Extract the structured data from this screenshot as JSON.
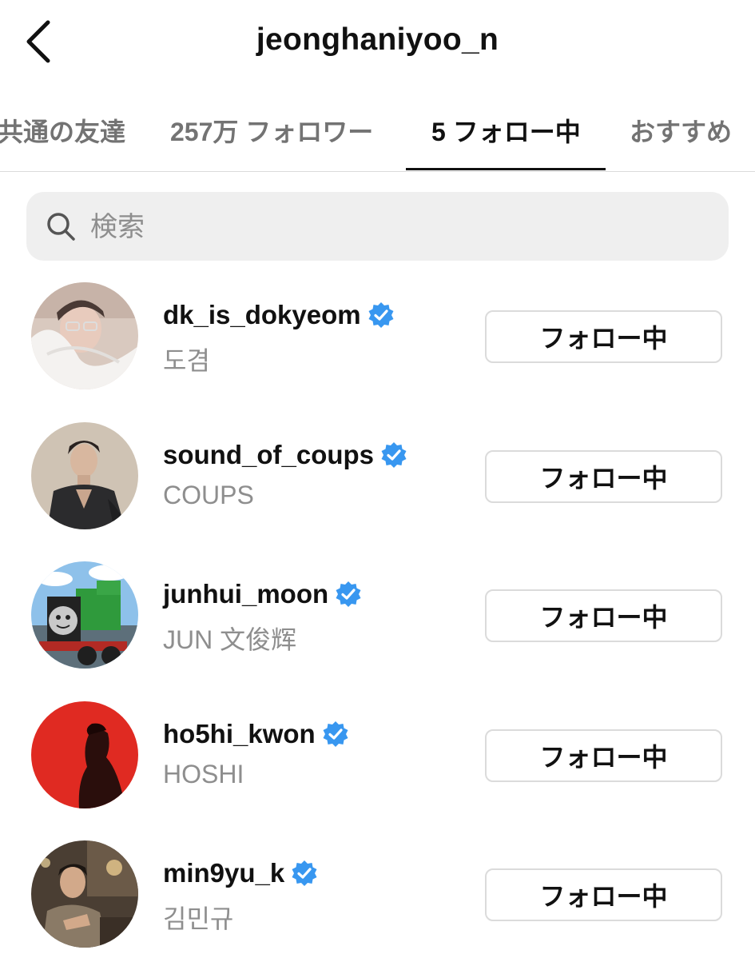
{
  "header": {
    "title": "jeonghaniyoo_n"
  },
  "tabs": [
    {
      "label": "共通の友達"
    },
    {
      "label": "257万 フォロワー"
    },
    {
      "label": "5 フォロー中"
    },
    {
      "label": "おすすめ"
    }
  ],
  "search": {
    "placeholder": "検索"
  },
  "users": [
    {
      "username": "dk_is_dokyeom",
      "fullname": "도겸",
      "button": "フォロー中"
    },
    {
      "username": "sound_of_coups",
      "fullname": "COUPS",
      "button": "フォロー中"
    },
    {
      "username": "junhui_moon",
      "fullname": "JUN 文俊辉",
      "button": "フォロー中"
    },
    {
      "username": "ho5hi_kwon",
      "fullname": "HOSHI",
      "button": "フォロー中"
    },
    {
      "username": "min9yu_k",
      "fullname": "김민규",
      "button": "フォロー中"
    }
  ],
  "colors": {
    "verified": "#3897f0",
    "text": "#111111",
    "muted": "#8e8e8e",
    "search_bg": "#efefef"
  }
}
